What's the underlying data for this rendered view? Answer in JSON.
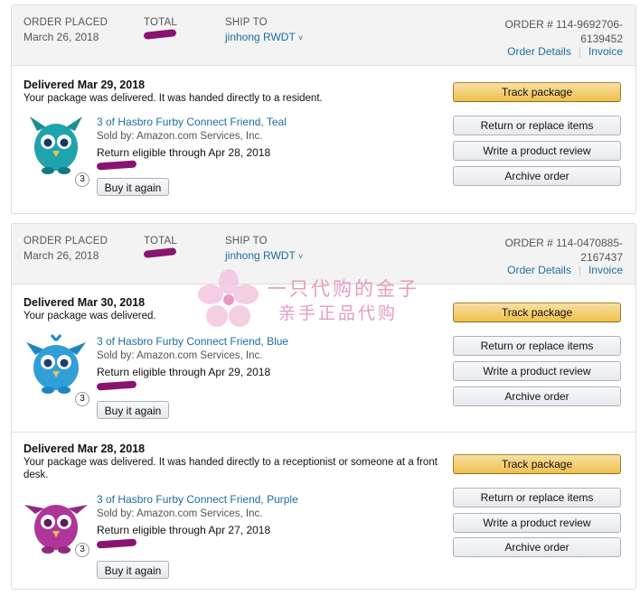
{
  "labels": {
    "order_placed": "ORDER PLACED",
    "total": "TOTAL",
    "ship_to": "SHIP TO",
    "order_details": "Order Details",
    "invoice": "Invoice",
    "track": "Track package",
    "return_replace": "Return or replace items",
    "write_review": "Write a product review",
    "archive": "Archive order",
    "buy_again": "Buy it again",
    "caret": "˅"
  },
  "orders": [
    {
      "placed": "March 26, 2018",
      "ship_to": "jinhong RWDT",
      "order_num_1": "ORDER # 114-9692706-",
      "order_num_2": "6139452",
      "shipments": [
        {
          "delivered": "Delivered Mar 29, 2018",
          "note": "Your package was delivered. It was handed directly to a resident.",
          "product": "3 of Hasbro Furby Connect Friend, Teal",
          "seller": "Sold by: Amazon.com Services, Inc.",
          "return": "Return eligible through Apr 28, 2018",
          "qty": "3",
          "color": "#1fa3ad"
        }
      ]
    },
    {
      "placed": "March 26, 2018",
      "ship_to": "jinhong RWDT",
      "order_num_1": "ORDER # 114-0470885-",
      "order_num_2": "2167437",
      "shipments": [
        {
          "delivered": "Delivered Mar 30, 2018",
          "note": "Your package was delivered.",
          "product": "3 of Hasbro Furby Connect Friend, Blue",
          "seller": "Sold by: Amazon.com Services, Inc.",
          "return": "Return eligible through Apr 29, 2018",
          "qty": "3",
          "color": "#2f9fd8"
        },
        {
          "delivered": "Delivered Mar 28, 2018",
          "note": "Your package was delivered. It was handed directly to a receptionist or someone at a front desk.",
          "product": "3 of Hasbro Furby Connect Friend, Purple",
          "seller": "Sold by: Amazon.com Services, Inc.",
          "return": "Return eligible through Apr 27, 2018",
          "qty": "3",
          "color": "#b0359a"
        }
      ]
    }
  ],
  "watermark": {
    "line1": "一只代购的金子",
    "line2": "亲手正品代购"
  }
}
